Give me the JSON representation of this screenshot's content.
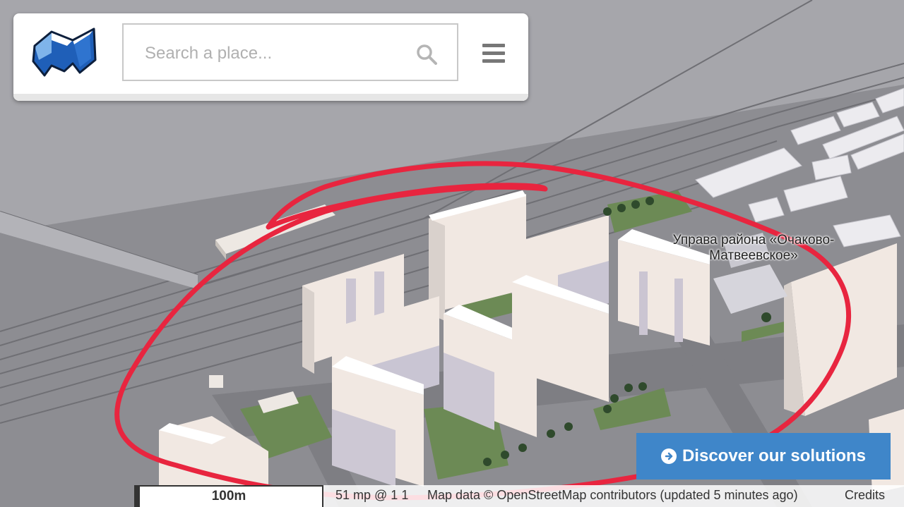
{
  "search": {
    "placeholder": "Search a place..."
  },
  "map": {
    "label_upper": "Управа района «Очаково-",
    "label_lower": "Матвеевское»"
  },
  "cta": {
    "label": "Discover our solutions"
  },
  "footer": {
    "scale": "100m",
    "coords": "51 mp @ 1 1",
    "attribution": "Map data © OpenStreetMap contributors (updated 5 minutes ago)",
    "credits": "Credits"
  },
  "colors": {
    "annotation": "#e8253f",
    "cta": "#3f86c9",
    "logo": "#1f5fb8"
  },
  "icons": [
    "app-logo-icon",
    "search-icon",
    "menu-icon",
    "arrow-circle-right-icon"
  ]
}
